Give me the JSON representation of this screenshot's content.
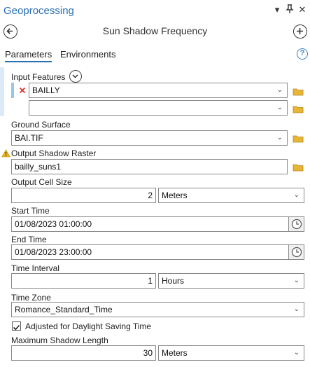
{
  "pane": {
    "title": "Geoprocessing",
    "tool_name": "Sun Shadow Frequency"
  },
  "tabs": [
    {
      "label": "Parameters",
      "active": true
    },
    {
      "label": "Environments",
      "active": false
    }
  ],
  "params": {
    "input_features": {
      "label": "Input Features",
      "rows": [
        "BAILLY",
        ""
      ]
    },
    "ground_surface": {
      "label": "Ground Surface",
      "value": "BAI.TIF"
    },
    "output_shadow": {
      "label": "Output Shadow Raster",
      "value": "bailly_suns1"
    },
    "cell_size": {
      "label": "Output Cell Size",
      "value": "2",
      "unit": "Meters"
    },
    "start_time": {
      "label": "Start Time",
      "value": "01/08/2023 01:00:00"
    },
    "end_time": {
      "label": "End Time",
      "value": "01/08/2023 23:00:00"
    },
    "time_interval": {
      "label": "Time Interval",
      "value": "1",
      "unit": "Hours"
    },
    "time_zone": {
      "label": "Time Zone",
      "value": "Romance_Standard_Time"
    },
    "dst": {
      "label": "Adjusted for Daylight Saving Time",
      "checked": true
    },
    "max_shadow": {
      "label": "Maximum Shadow Length",
      "value": "30",
      "unit": "Meters"
    }
  },
  "icons": {
    "remove": "x-icon",
    "browse": "folder-icon",
    "clock": "clock-icon",
    "warning": "warning-icon"
  },
  "colors": {
    "accent": "#2a6fb5",
    "folder": "#e8b637",
    "warning": "#f2b41c",
    "remove": "#d9342b"
  }
}
